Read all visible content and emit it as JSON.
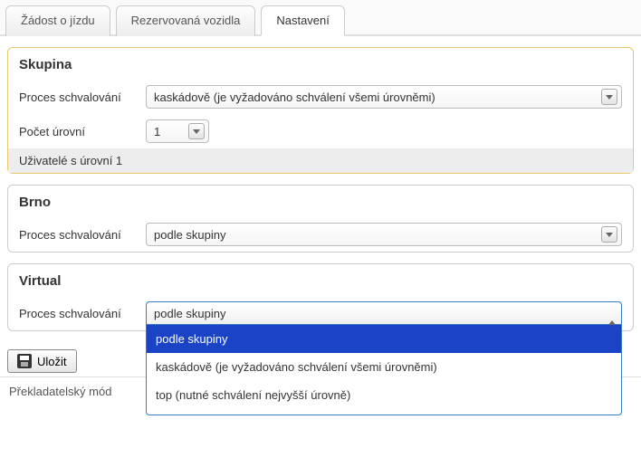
{
  "tabs": [
    {
      "label": "Žádost o jízdu"
    },
    {
      "label": "Rezervovaná vozidla"
    },
    {
      "label": "Nastavení"
    }
  ],
  "group_panel": {
    "title": "Skupina",
    "approval_label": "Proces schvalování",
    "approval_value": "kaskádově (je vyžadováno schválení všemi úrovněmi)",
    "levels_label": "Počet úrovní",
    "levels_value": "1",
    "users_label": "Uživatelé s úrovní 1"
  },
  "brno_panel": {
    "title": "Brno",
    "approval_label": "Proces schvalování",
    "approval_value": "podle skupiny"
  },
  "virtual_panel": {
    "title": "Virtual",
    "approval_label": "Proces schvalování",
    "current": "podle skupiny",
    "options": [
      "podle skupiny",
      "kaskádově (je vyžadováno schválení všemi úrovněmi)",
      "top (nutné schválení nejvyšší úrovně)"
    ]
  },
  "save_label": "Uložit",
  "footer": "Překladatelský mód"
}
